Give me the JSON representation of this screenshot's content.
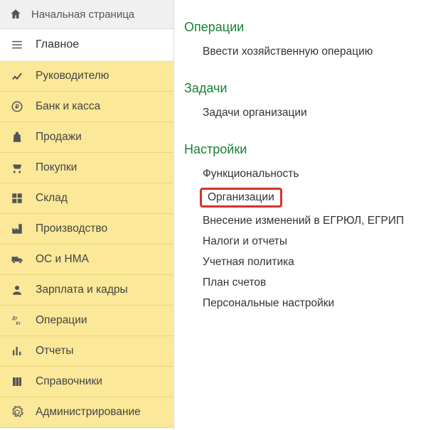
{
  "home": {
    "label": "Начальная страница"
  },
  "main": {
    "label": "Главное"
  },
  "sidebar": {
    "items": [
      {
        "label": "Руководителю",
        "icon": "trending-up-icon"
      },
      {
        "label": "Банк и касса",
        "icon": "ruble-icon"
      },
      {
        "label": "Продажи",
        "icon": "bag-icon"
      },
      {
        "label": "Покупки",
        "icon": "cart-icon"
      },
      {
        "label": "Склад",
        "icon": "grid-icon"
      },
      {
        "label": "Производство",
        "icon": "factory-icon"
      },
      {
        "label": "ОС и НМА",
        "icon": "truck-icon"
      },
      {
        "label": "Зарплата и кадры",
        "icon": "person-icon"
      },
      {
        "label": "Операции",
        "icon": "debit-credit-icon"
      },
      {
        "label": "Отчеты",
        "icon": "bar-chart-icon"
      },
      {
        "label": "Справочники",
        "icon": "books-icon"
      },
      {
        "label": "Администрирование",
        "icon": "gear-icon"
      }
    ]
  },
  "content": {
    "sections": [
      {
        "title": "Операции",
        "items": [
          {
            "label": "Ввести хозяйственную операцию",
            "highlighted": false
          }
        ]
      },
      {
        "title": "Задачи",
        "items": [
          {
            "label": "Задачи организации",
            "highlighted": false
          }
        ]
      },
      {
        "title": "Настройки",
        "items": [
          {
            "label": "Функциональность",
            "highlighted": false
          },
          {
            "label": "Организации",
            "highlighted": true
          },
          {
            "label": "Внесение изменений в ЕГРЮЛ, ЕГРИП",
            "highlighted": false
          },
          {
            "label": "Налоги и отчеты",
            "highlighted": false
          },
          {
            "label": "Учетная политика",
            "highlighted": false
          },
          {
            "label": "План счетов",
            "highlighted": false
          },
          {
            "label": "Персональные настройки",
            "highlighted": false
          }
        ]
      }
    ]
  }
}
